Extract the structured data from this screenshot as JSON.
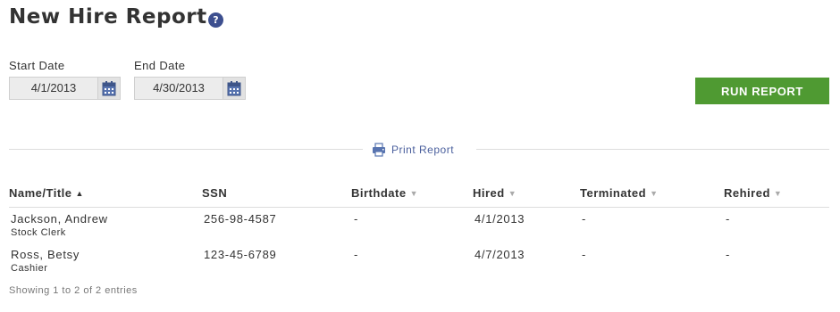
{
  "header": {
    "title": "New Hire Report",
    "help_icon": "question-circle-icon",
    "help_glyph": "?"
  },
  "filters": {
    "start_date_label": "Start Date",
    "start_date_value": "4/1/2013",
    "end_date_label": "End Date",
    "end_date_value": "4/30/2013",
    "calendar_icon": "calendar-icon"
  },
  "actions": {
    "run_report_label": "RUN REPORT",
    "print_label": "Print Report",
    "print_icon": "printer-icon"
  },
  "table": {
    "columns": [
      {
        "label": "Name/Title",
        "sort": "asc"
      },
      {
        "label": "SSN",
        "sort": "none"
      },
      {
        "label": "Birthdate",
        "sort": "sortable"
      },
      {
        "label": "Hired",
        "sort": "sortable"
      },
      {
        "label": "Terminated",
        "sort": "sortable"
      },
      {
        "label": "Rehired",
        "sort": "sortable"
      }
    ],
    "rows": [
      {
        "name": "Jackson, Andrew",
        "title": "Stock Clerk",
        "ssn": "256-98-4587",
        "birthdate": "-",
        "hired": "4/1/2013",
        "terminated": "-",
        "rehired": "-"
      },
      {
        "name": "Ross, Betsy",
        "title": "Cashier",
        "ssn": "123-45-6789",
        "birthdate": "-",
        "hired": "4/7/2013",
        "terminated": "-",
        "rehired": "-"
      }
    ],
    "info": "Showing 1 to 2 of 2 entries"
  },
  "colors": {
    "accent_green": "#4f9a32",
    "link_blue": "#4a5f9d",
    "help_icon_blue": "#3d4f8f"
  }
}
